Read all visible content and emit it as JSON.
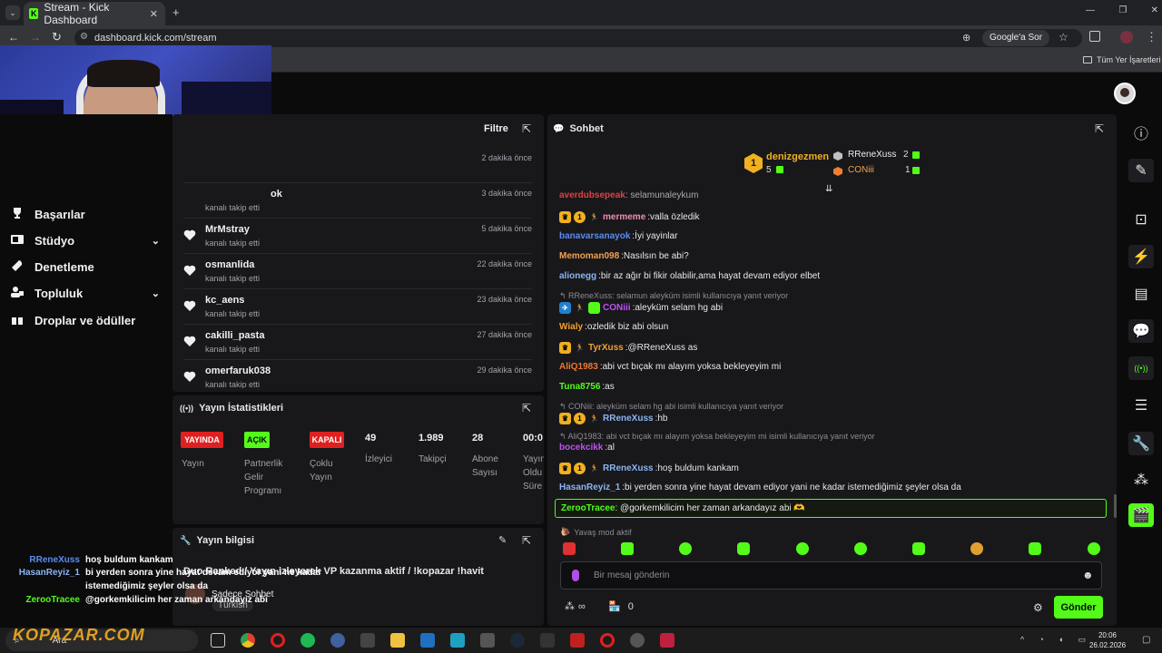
{
  "browser": {
    "tab_title": "Stream - Kick Dashboard",
    "url": "dashboard.kick.com/stream",
    "google_btn": "Google'a Sor",
    "bookmarks_all": "Tüm Yer İşaretleri"
  },
  "sidebar": {
    "items": [
      {
        "label": "Başarılar",
        "icon": "trophy-icon"
      },
      {
        "label": "Stüdyo",
        "icon": "camera-icon"
      },
      {
        "label": "Denetleme",
        "icon": "wrench-icon"
      },
      {
        "label": "Topluluk",
        "icon": "people-icon"
      },
      {
        "label": "Droplar ve ödüller",
        "icon": "gift-icon"
      }
    ]
  },
  "activity": {
    "filter": "Filtre",
    "events": [
      {
        "name": "",
        "sub": "",
        "time": "2 dakika önce"
      },
      {
        "name": "ok",
        "sub": "kanalı takip etti",
        "time": "3 dakika önce"
      },
      {
        "name": "MrMstray",
        "sub": "kanalı takip etti",
        "time": "5 dakika önce"
      },
      {
        "name": "osmanlida",
        "sub": "kanalı takip etti",
        "time": "22 dakika önce"
      },
      {
        "name": "kc_aens",
        "sub": "kanalı takip etti",
        "time": "23 dakika önce"
      },
      {
        "name": "cakilli_pasta",
        "sub": "kanalı takip etti",
        "time": "27 dakika önce"
      },
      {
        "name": "omerfaruk038",
        "sub": "kanalı takip etti",
        "time": "29 dakika önce"
      }
    ]
  },
  "stats": {
    "title": "Yayın İstatistikleri",
    "badges": [
      {
        "text": "YAYINDA",
        "label": "Yayın",
        "color": "#e02020"
      },
      {
        "text": "AÇIK",
        "label": "Partnerlik Gelir Programı",
        "color": "#53fc18"
      },
      {
        "text": "KAPALI",
        "label": "Çoklu Yayın",
        "color": "#e02020"
      }
    ],
    "numbers": [
      {
        "value": "49",
        "label": "İzleyici"
      },
      {
        "value": "1.989",
        "label": "Takipçi"
      },
      {
        "value": "28",
        "label": "Abone Sayısı"
      },
      {
        "value": "00:0",
        "label": "Yayın Oldu Süre"
      }
    ]
  },
  "info": {
    "title": "Yayın bilgisi",
    "stream_title": "Duo Ranked / Yayın izleyerek VP kazanma aktif / !kopazar !havit",
    "chat_mode": "Sadece Sohbet",
    "language": "Türkish"
  },
  "chat": {
    "title": "Sohbet",
    "leaders": {
      "first": {
        "name": "denizgezmen",
        "count": "5",
        "rank": "1"
      },
      "second": {
        "name": "RReneXuss",
        "count": "2"
      },
      "third": {
        "name": "CONiii",
        "count": "1"
      }
    },
    "partial_line": "selamunaleykum",
    "messages": [
      {
        "user": "mermeme",
        "color": "#f08cb4",
        "text": "valla özledik"
      },
      {
        "user": "banavarsanayok",
        "color": "#5c8cf0",
        "text": "İyi yayinlar"
      },
      {
        "user": "Memoman098",
        "color": "#f0a050",
        "text": "Nasılsın be abi?"
      },
      {
        "user": "alionegg",
        "color": "#8cb4f0",
        "text": "bir az ağır bi fikir olabilir,ama hayat devam ediyor elbet"
      },
      {
        "reply": "RReneXuss: selamun aleyküm isimli kullanıcıya yanıt veriyor"
      },
      {
        "user": "CONiii",
        "color": "#c050f0",
        "text": "aleyküm selam hg abi"
      },
      {
        "user": "Wialy",
        "color": "#f0a030",
        "text": "ozledik biz abi olsun"
      },
      {
        "user": "TyrXuss",
        "color": "#f0a030",
        "text": "@RReneXuss as"
      },
      {
        "user": "AliQ1983",
        "color": "#f07830",
        "text": "abi vct bıçak mı alayım yoksa bekleyeyim mi"
      },
      {
        "user": "Tuna8756",
        "color": "#53fc18",
        "text": "as"
      },
      {
        "reply": "CONiii: aleyküm selam hg abi isimli kullanıcıya yanıt veriyor"
      },
      {
        "user": "RReneXuss",
        "color": "#8cb4f0",
        "text": "hb"
      },
      {
        "reply": "AliQ1983: abi vct bıçak mı alayım yoksa bekleyeyim mi isimli kullanıcıya yanıt veriyor"
      },
      {
        "user": "bocekcikk",
        "color": "#c050f0",
        "text": "al"
      },
      {
        "user": "RReneXuss",
        "color": "#8cb4f0",
        "text": "hoş buldum kankam"
      },
      {
        "user": "HasanReyiz_1",
        "color": "#8cb4f0",
        "text": "bi yerden sonra yine hayat devam ediyor yani ne kadar istemediğimiz şeyler olsa da"
      }
    ],
    "highlight": {
      "user": "ZerooTracee",
      "text": "@gorkemkilicim her zaman arkandayız abi 🫶"
    },
    "slow_mode": "Yavaş mod aktif",
    "placeholder": "Bir mesaj gönderin",
    "points": "0",
    "send": "Gönder"
  },
  "overlay": {
    "lines": [
      {
        "user": "RReneXuss",
        "text": "hoş buldum kankam"
      },
      {
        "user": "HasanReyiz_1",
        "text": "bi yerden sonra yine hayat devam ediyor yani ne kadar"
      },
      {
        "user": "",
        "text": "istemediğimiz şeyler olsa da"
      },
      {
        "user": "ZerooTracee",
        "text": "@gorkemkilicim her zaman arkandayız abi"
      }
    ],
    "watermark": "KOPAZAR.COM"
  },
  "taskbar": {
    "search": "Ara",
    "time": "20:06",
    "date": "26.02.2026"
  },
  "colors": {
    "accent": "#53fc18",
    "panel": "#18181b",
    "bg": "#0b0b0c"
  }
}
